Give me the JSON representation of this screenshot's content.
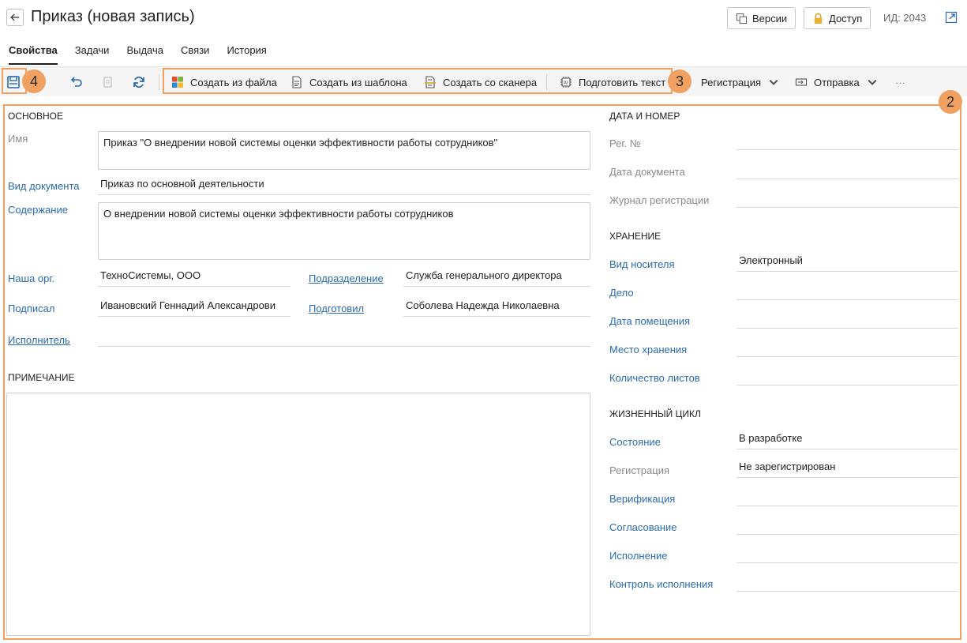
{
  "header": {
    "title": "Приказ (новая запись)",
    "versions_label": "Версии",
    "access_label": "Доступ",
    "id_label": "ИД: 2043"
  },
  "tabs": [
    {
      "label": "Свойства",
      "active": true
    },
    {
      "label": "Задачи"
    },
    {
      "label": "Выдача"
    },
    {
      "label": "Связи"
    },
    {
      "label": "История"
    }
  ],
  "toolbar": {
    "create_from_file": "Создать из файла",
    "create_from_template": "Создать из шаблона",
    "create_from_scanner": "Создать со сканера",
    "prepare_text": "Подготовить текст",
    "registration": "Регистрация",
    "sending": "Отправка",
    "more": "···"
  },
  "callouts": {
    "c2": "2",
    "c3": "3",
    "c4": "4"
  },
  "main": {
    "section_title": "ОСНОВНОЕ",
    "name_label": "Имя",
    "name_value": "Приказ \"О внедрении новой системы оценки эффективности работы сотрудников\"",
    "doc_kind_label": "Вид документа",
    "doc_kind_value": "Приказ по основной деятельности",
    "content_label": "Содержание",
    "content_value": "О внедрении новой системы оценки эффективности работы сотрудников",
    "our_org_label": "Наша орг.",
    "our_org_value": "ТехноСистемы, ООО",
    "department_label": "Подразделение",
    "department_value": "Служба генерального директора",
    "signed_label": "Подписал",
    "signed_value": "Ивановский Геннадий Александрови",
    "prepared_label": "Подготовил",
    "prepared_value": "Соболева Надежда Николаевна",
    "executor_label": "Исполнитель",
    "executor_value": ""
  },
  "note": {
    "section_title": "ПРИМЕЧАНИЕ",
    "value": ""
  },
  "date_number": {
    "section_title": "ДАТА И НОМЕР",
    "reg_no_label": "Рег. №",
    "doc_date_label": "Дата документа",
    "journal_label": "Журнал регистрации"
  },
  "storage": {
    "section_title": "ХРАНЕНИЕ",
    "medium_label": "Вид носителя",
    "medium_value": "Электронный",
    "case_label": "Дело",
    "placement_date_label": "Дата помещения",
    "place_label": "Место хранения",
    "sheets_label": "Количество листов"
  },
  "lifecycle": {
    "section_title": "ЖИЗНЕННЫЙ ЦИКЛ",
    "state_label": "Состояние",
    "state_value": "В разработке",
    "registration_label": "Регистрация",
    "registration_value": "Не зарегистрирован",
    "verification_label": "Верификация",
    "approval_label": "Согласование",
    "execution_label": "Исполнение",
    "control_label": "Контроль исполнения"
  },
  "colors": {
    "accent": "#2a6bb0",
    "callout": "#f0a060"
  }
}
